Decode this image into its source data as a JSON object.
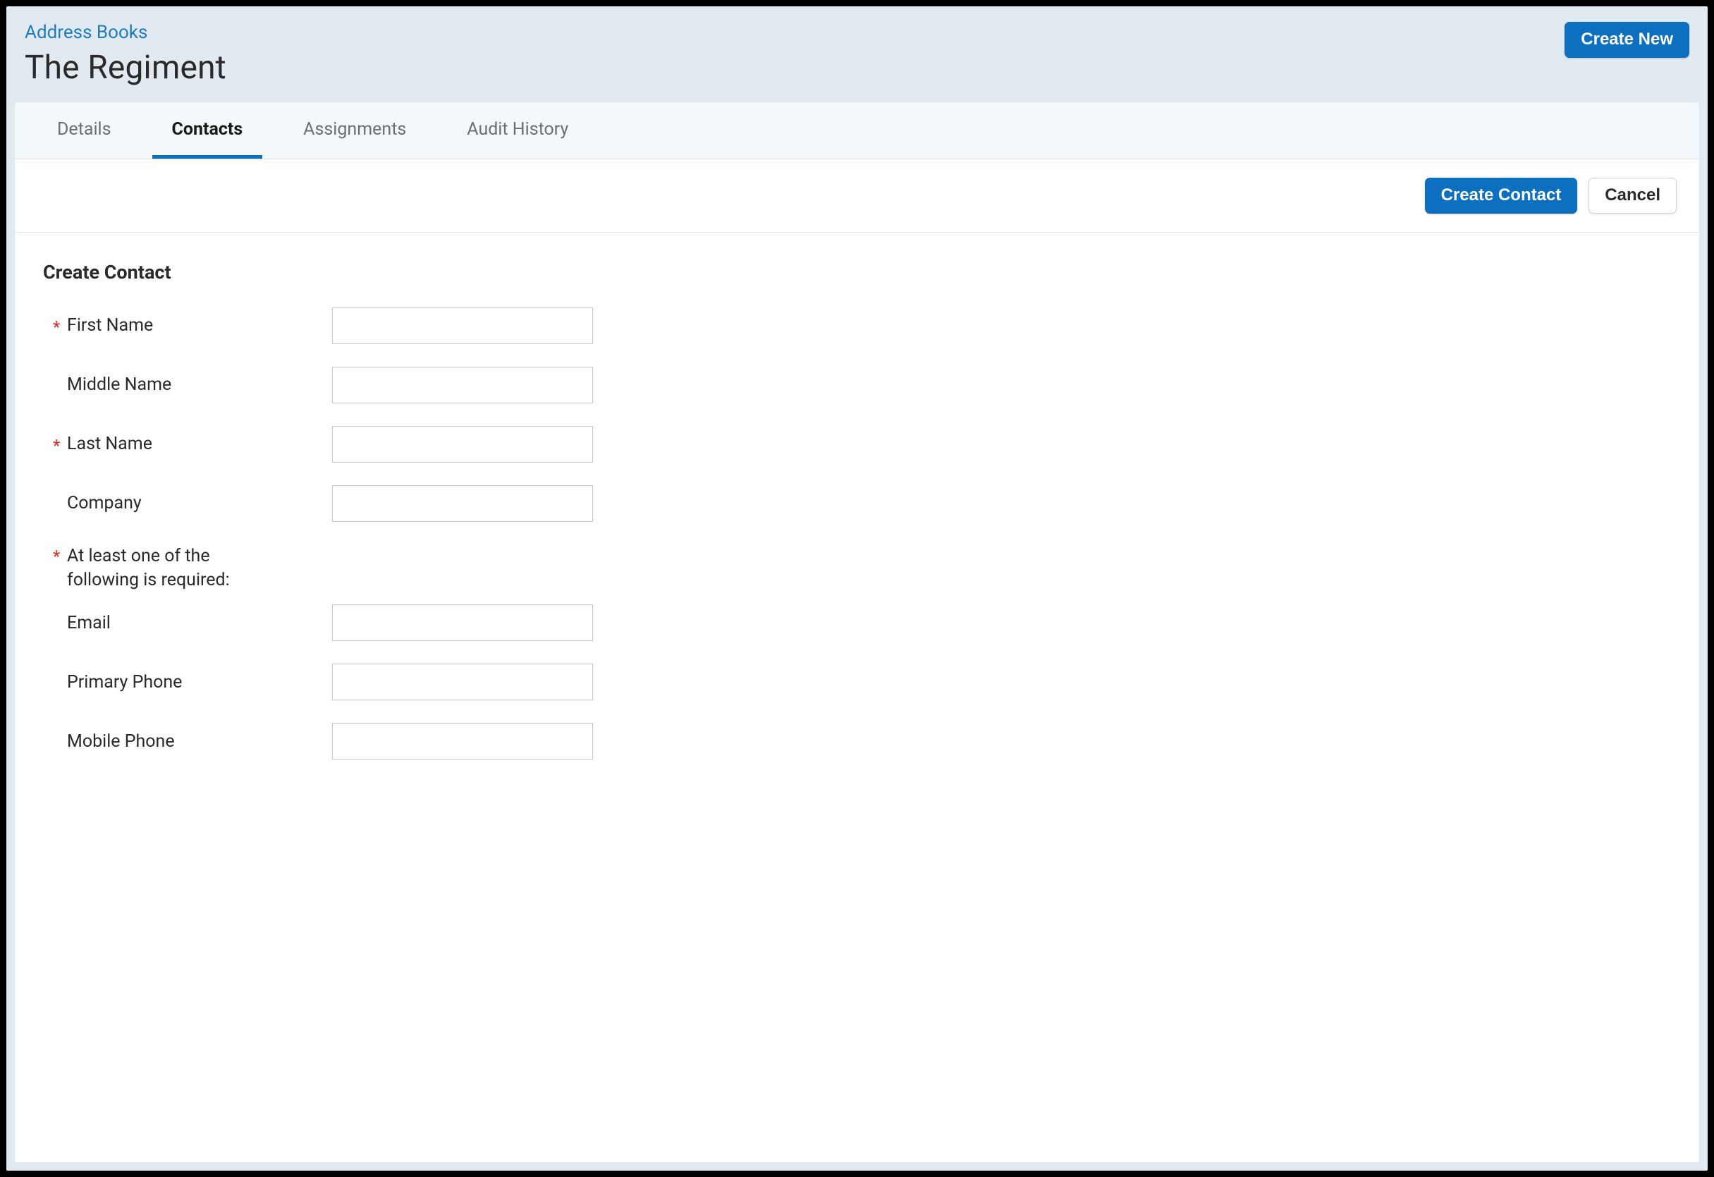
{
  "header": {
    "breadcrumb": "Address Books",
    "title": "The Regiment",
    "create_new": "Create New"
  },
  "tabs": {
    "details": "Details",
    "contacts": "Contacts",
    "assignments": "Assignments",
    "audit_history": "Audit History"
  },
  "toolbar": {
    "create_contact": "Create Contact",
    "cancel": "Cancel"
  },
  "form": {
    "section_title": "Create Contact",
    "required_note": "At least one of the following is required:",
    "fields": {
      "first_name": {
        "label": "First Name",
        "value": ""
      },
      "middle_name": {
        "label": "Middle Name",
        "value": ""
      },
      "last_name": {
        "label": "Last Name",
        "value": ""
      },
      "company": {
        "label": "Company",
        "value": ""
      },
      "email": {
        "label": "Email",
        "value": ""
      },
      "primary_phone": {
        "label": "Primary Phone",
        "value": ""
      },
      "mobile_phone": {
        "label": "Mobile Phone",
        "value": ""
      }
    }
  }
}
